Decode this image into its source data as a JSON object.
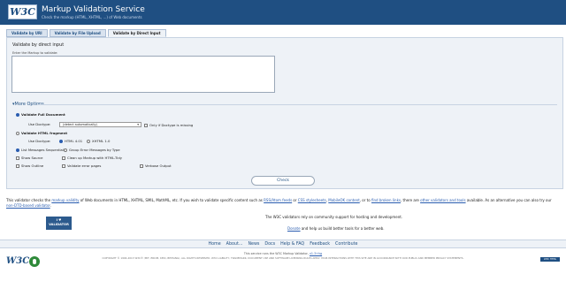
{
  "header": {
    "logo": "W3C",
    "title": "Markup Validation Service",
    "subtitle": "Check the markup (HTML, XHTML, ...) of Web documents"
  },
  "tabs": [
    {
      "label": "Validate by URI"
    },
    {
      "label": "Validate by File Upload"
    },
    {
      "label": "Validate by Direct Input"
    }
  ],
  "panel": {
    "title": "Validate by direct input",
    "textarea_label": "Enter the Markup to validate:",
    "textarea_value": ""
  },
  "options": {
    "toggle_label": "More Options",
    "full_doc": "Validate Full Document",
    "use_doctype": "Use Doctype:",
    "doctype_select": "(detect automatically)",
    "only_if_missing": "Only if Doctype is missing",
    "html_fragment": "Validate HTML fragment",
    "html401": "HTML 4.01",
    "xhtml10": "XHTML 1.0",
    "list_seq": "List Messages Sequentially",
    "group_errors": "Group Error Messages by Type",
    "show_source": "Show Source",
    "cleanup": "Clean up Markup with HTML-Tidy",
    "show_outline": "Show Outline",
    "validate_error_pages": "Validate error pages",
    "verbose": "Verbose Output"
  },
  "check_button": "Check",
  "about": {
    "p1": "This validator checks the ",
    "l1": "markup validity",
    "p2": " of Web documents in HTML, XHTML, SMIL, MathML, etc. If you wish to validate specific content such as ",
    "l2": "RSS/Atom feeds",
    "p3": " or ",
    "l3": "CSS stylesheets",
    "p4": ", ",
    "l4": "MobileOK content",
    "p5": ", or to ",
    "l5": "find broken links",
    "p6": ", there are ",
    "l6": "other validators and tools",
    "p7": " available. As an alternative you can also try our ",
    "l7": "non-DTD-based validator",
    "p8": "."
  },
  "badge": {
    "line1": "I ♥",
    "line2": "VALIDATOR"
  },
  "support": {
    "line1": "The W3C validators rely on community support for hosting and development.",
    "donate": "Donate",
    "line2_rest": " and help us build better tools for a better web."
  },
  "footer_nav": [
    "Home",
    "About...",
    "News",
    "Docs",
    "Help & FAQ",
    "Feedback",
    "Contribute"
  ],
  "footer": {
    "w3c": "W3C",
    "service_pre": "This service runs the W3C Markup Validator, ",
    "service_version": "v1.3+hg",
    "copyright": "COPYRIGHT © 1994-2013 W3C® (MIT, ERCIM, KEIO, BEIHANG), ALL RIGHTS RESERVED. W3C LIABILITY, TRADEMARK, DOCUMENT USE AND SOFTWARE LICENSING RULES APPLY. YOUR INTERACTIONS WITH THIS SITE ARE IN ACCORDANCE WITH OUR PUBLIC AND MEMBER PRIVACY STATEMENTS.",
    "badge": "W3C HTML"
  }
}
